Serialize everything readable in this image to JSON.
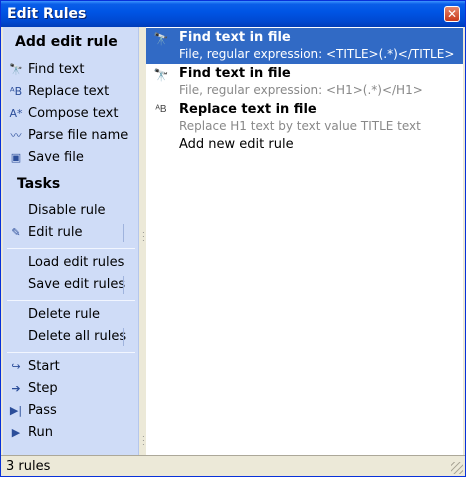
{
  "window": {
    "title": "Edit Rules",
    "close_glyph": "✕"
  },
  "sidebar": {
    "add_group_title": "Add edit rule",
    "add_items": [
      {
        "label": "Find text",
        "icon": "binoculars-icon",
        "glyph": "🔭"
      },
      {
        "label": "Replace text",
        "icon": "replace-text-icon",
        "glyph": "ᴬB"
      },
      {
        "label": "Compose text",
        "icon": "compose-text-icon",
        "glyph": "A*"
      },
      {
        "label": "Parse file name",
        "icon": "parse-file-name-icon",
        "glyph": "〰"
      },
      {
        "label": "Save file",
        "icon": "floppy-disk-icon",
        "glyph": "▣"
      }
    ],
    "tasks_group_title": "Tasks",
    "task_items": [
      {
        "label": "Disable rule"
      },
      {
        "label": "Edit rule",
        "icon": "edit-rule-icon",
        "glyph": "✎"
      },
      {
        "label": "Load edit rules"
      },
      {
        "label": "Save edit rules"
      },
      {
        "label": "Delete rule"
      },
      {
        "label": "Delete all rules"
      },
      {
        "label": "Start",
        "icon": "start-arrow-icon",
        "glyph": "↪"
      },
      {
        "label": "Step",
        "icon": "step-arrow-icon",
        "glyph": "➔"
      },
      {
        "label": "Pass",
        "icon": "pass-icon",
        "glyph": "▶|"
      },
      {
        "label": "Run",
        "icon": "run-icon",
        "glyph": "▶"
      }
    ]
  },
  "rules": [
    {
      "name": "Find text in file",
      "description": "File, regular expression: <TITLE>(.*)</TITLE>",
      "icon": "binoculars-icon",
      "glyph": "🔭",
      "selected": true
    },
    {
      "name": "Find text in file",
      "description": "File, regular expression: <H1>(.*)</H1>",
      "icon": "binoculars-icon",
      "glyph": "🔭",
      "selected": false
    },
    {
      "name": "Replace text in file",
      "description": "Replace H1 text by text value TITLE text",
      "icon": "replace-text-icon",
      "glyph": "ᴬB",
      "selected": false
    }
  ],
  "add_new_rule_label": "Add new edit rule",
  "status": {
    "text": "3 rules"
  },
  "colors": {
    "selection": "#316ac5",
    "sidebar_bg": "#cfdcf7",
    "titlebar": "#0055e5"
  }
}
